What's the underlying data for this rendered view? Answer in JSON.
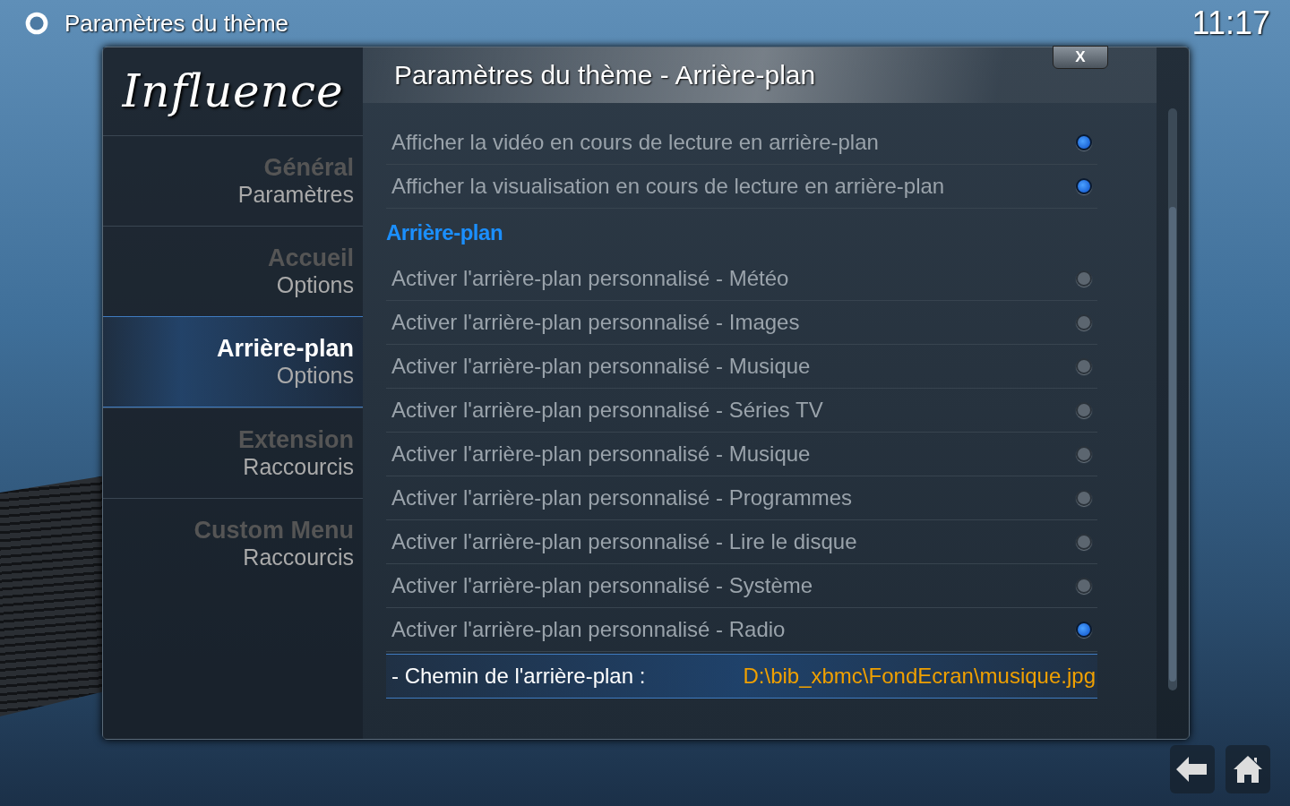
{
  "top_bar": {
    "title": "Paramètres du thème",
    "clock": "11:17"
  },
  "logo": "Influence",
  "sidebar": {
    "items": [
      {
        "title": "Général",
        "subtitle": "Paramètres",
        "selected": false
      },
      {
        "title": "Accueil",
        "subtitle": "Options",
        "selected": false
      },
      {
        "title": "Arrière-plan",
        "subtitle": "Options",
        "selected": true
      },
      {
        "title": "Extension",
        "subtitle": "Raccourcis",
        "selected": false
      },
      {
        "title": "Custom Menu",
        "subtitle": "Raccourcis",
        "selected": false
      }
    ]
  },
  "dialog": {
    "title": "Paramètres du thème - Arrière-plan",
    "close": "X"
  },
  "settings": [
    {
      "kind": "toggle",
      "label": "Afficher la vidéo en cours de lecture en arrière-plan",
      "on": true
    },
    {
      "kind": "toggle",
      "label": "Afficher la visualisation en cours de lecture en arrière-plan",
      "on": true
    },
    {
      "kind": "section",
      "label": "Arrière-plan"
    },
    {
      "kind": "toggle",
      "label": "Activer l'arrière-plan personnalisé - Météo",
      "on": false
    },
    {
      "kind": "toggle",
      "label": "Activer l'arrière-plan personnalisé - Images",
      "on": false
    },
    {
      "kind": "toggle",
      "label": "Activer l'arrière-plan personnalisé - Musique",
      "on": false
    },
    {
      "kind": "toggle",
      "label": "Activer l'arrière-plan personnalisé - Séries TV",
      "on": false
    },
    {
      "kind": "toggle",
      "label": "Activer l'arrière-plan personnalisé - Musique",
      "on": false
    },
    {
      "kind": "toggle",
      "label": "Activer l'arrière-plan personnalisé - Programmes",
      "on": false
    },
    {
      "kind": "toggle",
      "label": "Activer l'arrière-plan personnalisé - Lire le disque",
      "on": false
    },
    {
      "kind": "toggle",
      "label": "Activer l'arrière-plan personnalisé - Système",
      "on": false
    },
    {
      "kind": "toggle",
      "label": "Activer l'arrière-plan personnalisé - Radio",
      "on": true
    },
    {
      "kind": "path",
      "label": "- Chemin de l'arrière-plan :",
      "value": "D:\\bib_xbmc\\FondEcran\\musique.jpg",
      "selected": true
    }
  ]
}
